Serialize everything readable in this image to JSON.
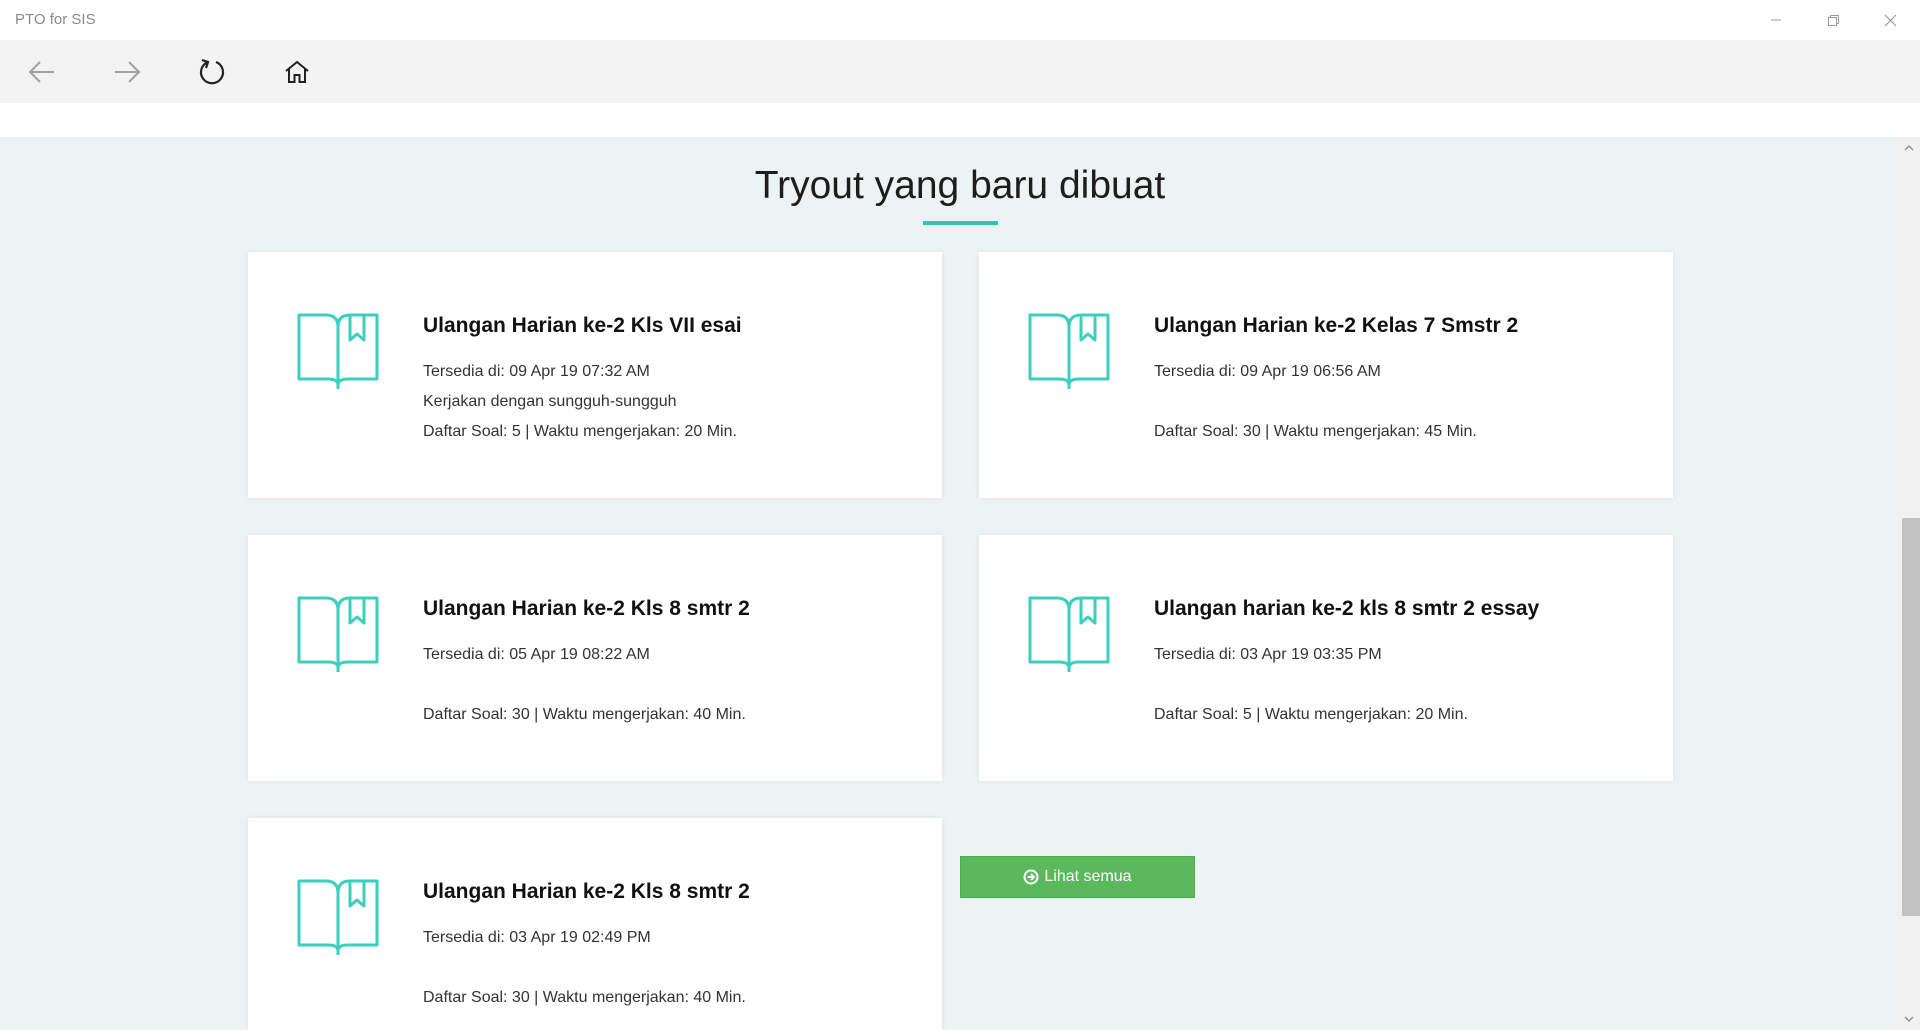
{
  "window": {
    "title": "PTO for SIS"
  },
  "section": {
    "title": "Tryout yang baru dibuat"
  },
  "cards": [
    {
      "title": "Ulangan Harian ke-2 Kls VII esai",
      "available": "Tersedia di: 09 Apr 19 07:32 AM",
      "description": "Kerjakan dengan sungguh-sungguh",
      "meta": "Daftar Soal: 5 | Waktu mengerjakan: 20 Min."
    },
    {
      "title": "Ulangan Harian ke-2 Kelas 7 Smstr 2",
      "available": "Tersedia di: 09 Apr 19 06:56 AM",
      "description": "",
      "meta": "Daftar Soal: 30 | Waktu mengerjakan: 45 Min."
    },
    {
      "title": "Ulangan Harian ke-2 Kls 8 smtr 2",
      "available": "Tersedia di: 05 Apr 19 08:22 AM",
      "description": "",
      "meta": "Daftar Soal: 30 | Waktu mengerjakan: 40 Min."
    },
    {
      "title": "Ulangan harian ke-2 kls 8 smtr 2 essay",
      "available": "Tersedia di: 03 Apr 19 03:35 PM",
      "description": "",
      "meta": "Daftar Soal: 5 | Waktu mengerjakan: 20 Min."
    },
    {
      "title": "Ulangan Harian ke-2 Kls 8 smtr 2",
      "available": "Tersedia di: 03 Apr 19 02:49 PM",
      "description": "",
      "meta": "Daftar Soal: 30 | Waktu mengerjakan: 40 Min."
    }
  ],
  "buttons": {
    "see_all": "Lihat semua"
  },
  "icons": {
    "card": "open-book-icon",
    "see_all": "arrow-circle-right-icon"
  },
  "colors": {
    "accent": "#2ec4b0",
    "button": "#5cb85c",
    "background": "#edf2f2"
  }
}
